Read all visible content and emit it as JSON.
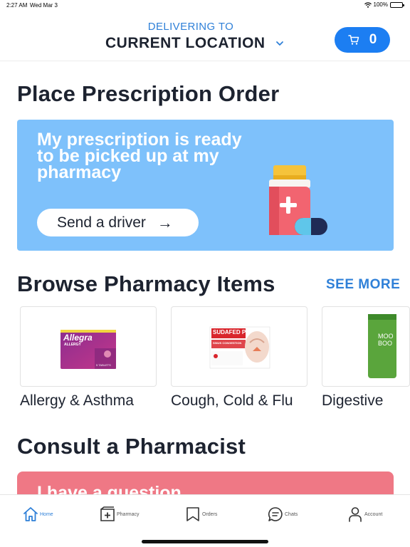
{
  "status": {
    "time": "2:27 AM",
    "date": "Wed Mar 3",
    "battery": "100%"
  },
  "header": {
    "delivering_label": "DELIVERING TO",
    "location": "CURRENT LOCATION",
    "cart_count": "0"
  },
  "prescription": {
    "section_title": "Place Prescription Order",
    "card_text": "My prescription is ready to be picked up at my pharmacy",
    "button_label": "Send a driver",
    "arrow": "→"
  },
  "browse": {
    "section_title": "Browse Pharmacy Items",
    "see_more": "SEE MORE",
    "categories": [
      {
        "label": "Allergy & Asthma",
        "product_brand": "Allegra",
        "product_sub": "ALLERGY",
        "product_count": "5 TABLETS"
      },
      {
        "label": "Cough, Cold & Flu",
        "product_brand": "SUDAFED PE",
        "product_sub": "SINUS CONGESTION"
      },
      {
        "label": "Digestive",
        "product_brand": "MOO BOO"
      }
    ]
  },
  "consult": {
    "section_title": "Consult a Pharmacist",
    "card_text": "I have a question"
  },
  "tabs": [
    {
      "label": "Home",
      "icon": "home-icon",
      "active": true
    },
    {
      "label": "Pharmacy",
      "icon": "pharmacy-icon",
      "active": false
    },
    {
      "label": "Orders",
      "icon": "bookmark-icon",
      "active": false
    },
    {
      "label": "Chats",
      "icon": "chat-icon",
      "active": false
    },
    {
      "label": "Account",
      "icon": "person-icon",
      "active": false
    }
  ],
  "colors": {
    "accent": "#1c7ef2",
    "rx_card": "#7ec1fb",
    "consult_card": "#ef7885",
    "text": "#1d2330"
  }
}
